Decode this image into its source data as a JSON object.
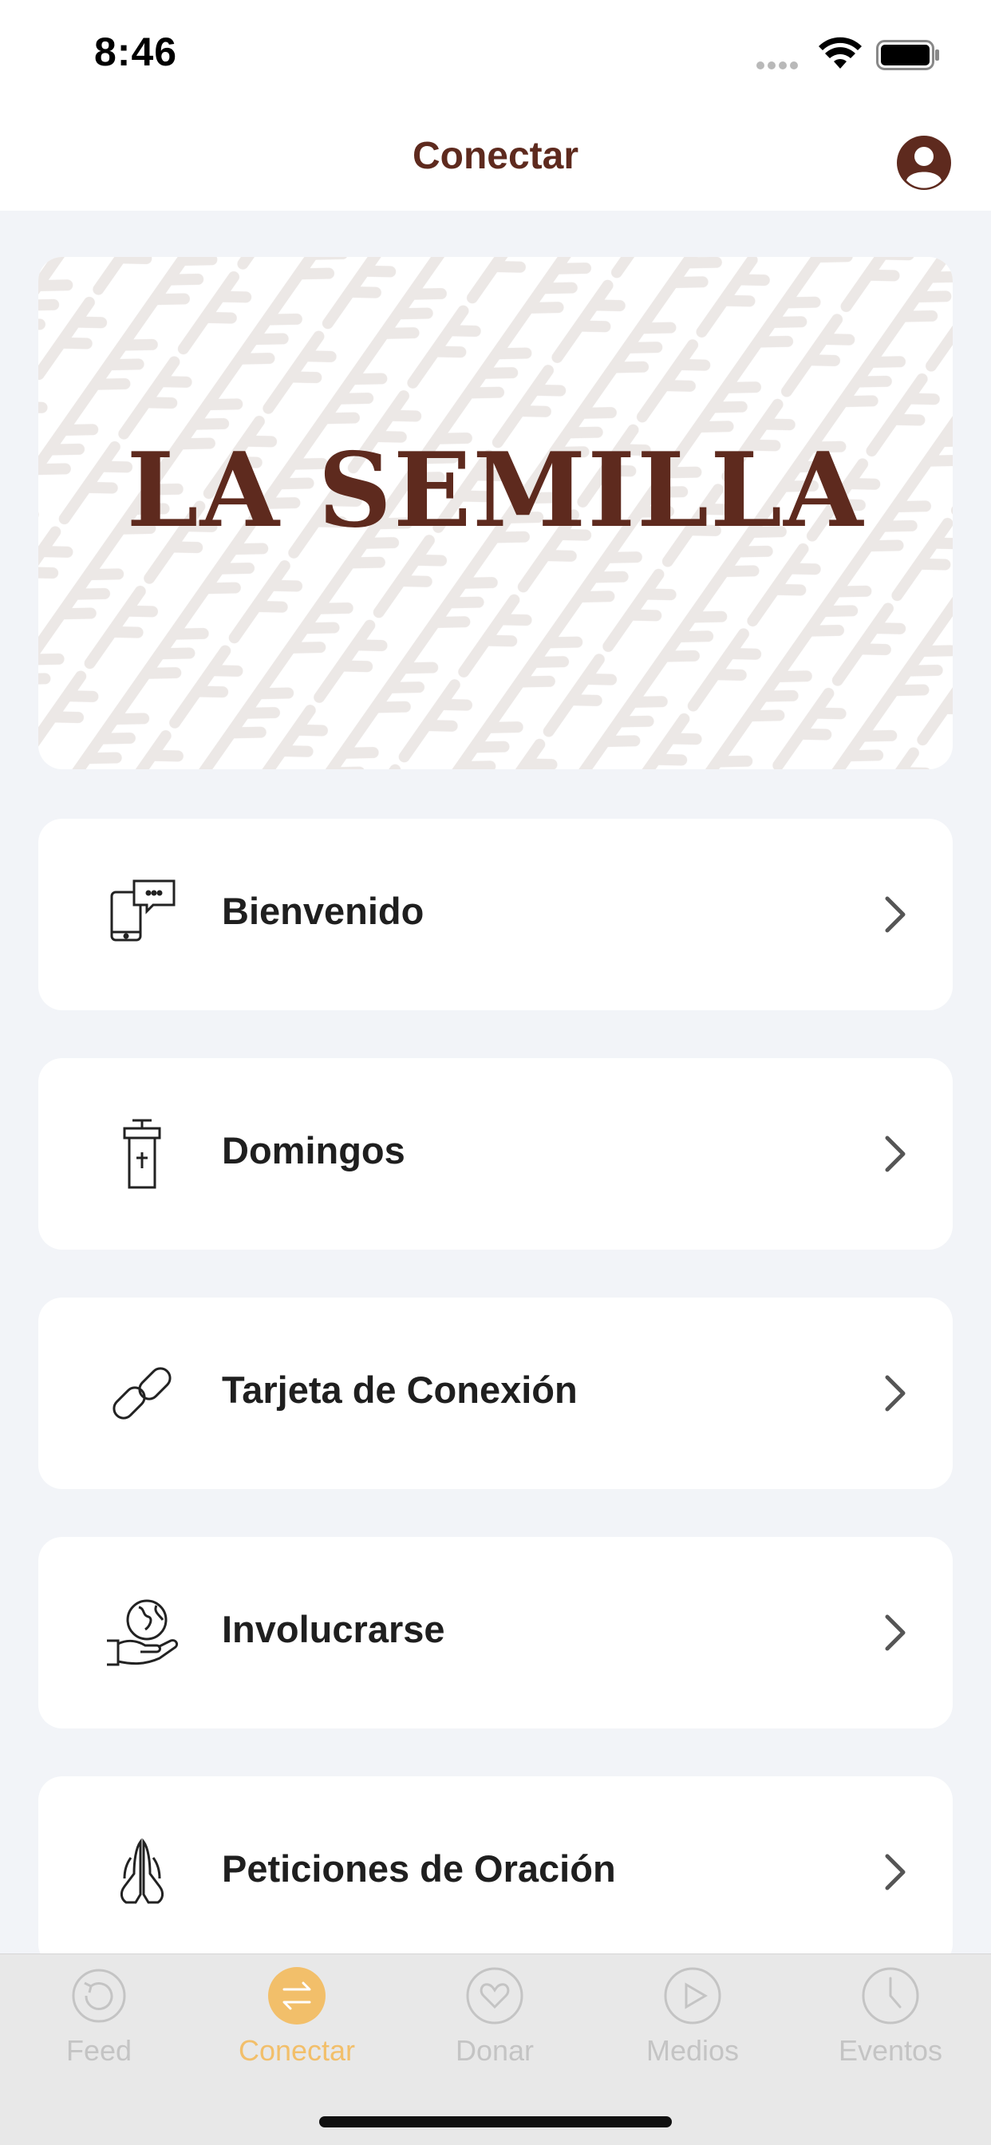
{
  "status_bar": {
    "time": "8:46"
  },
  "nav": {
    "title": "Conectar",
    "profile_icon": "person-circle-icon"
  },
  "banner": {
    "title": "LA SEMILLA"
  },
  "menu": [
    {
      "label": "Bienvenido",
      "icon": "phone-chat-icon"
    },
    {
      "label": "Domingos",
      "icon": "pulpit-icon"
    },
    {
      "label": "Tarjeta de Conexión",
      "icon": "link-icon"
    },
    {
      "label": "Involucrarse",
      "icon": "globe-hand-icon"
    },
    {
      "label": "Peticiones de Oración",
      "icon": "praying-hands-icon"
    }
  ],
  "tabs": [
    {
      "label": "Feed",
      "icon": "refresh-icon",
      "active": false
    },
    {
      "label": "Conectar",
      "icon": "arrows-exchange-icon",
      "active": true
    },
    {
      "label": "Donar",
      "icon": "heart-icon",
      "active": false
    },
    {
      "label": "Medios",
      "icon": "play-icon",
      "active": false
    },
    {
      "label": "Eventos",
      "icon": "clock-icon",
      "active": false
    }
  ],
  "colors": {
    "brand": "#5e2a1e",
    "active_tab": "#f2bf6a",
    "inactive_tab": "#c4c4c4",
    "background": "#f2f4f8"
  }
}
